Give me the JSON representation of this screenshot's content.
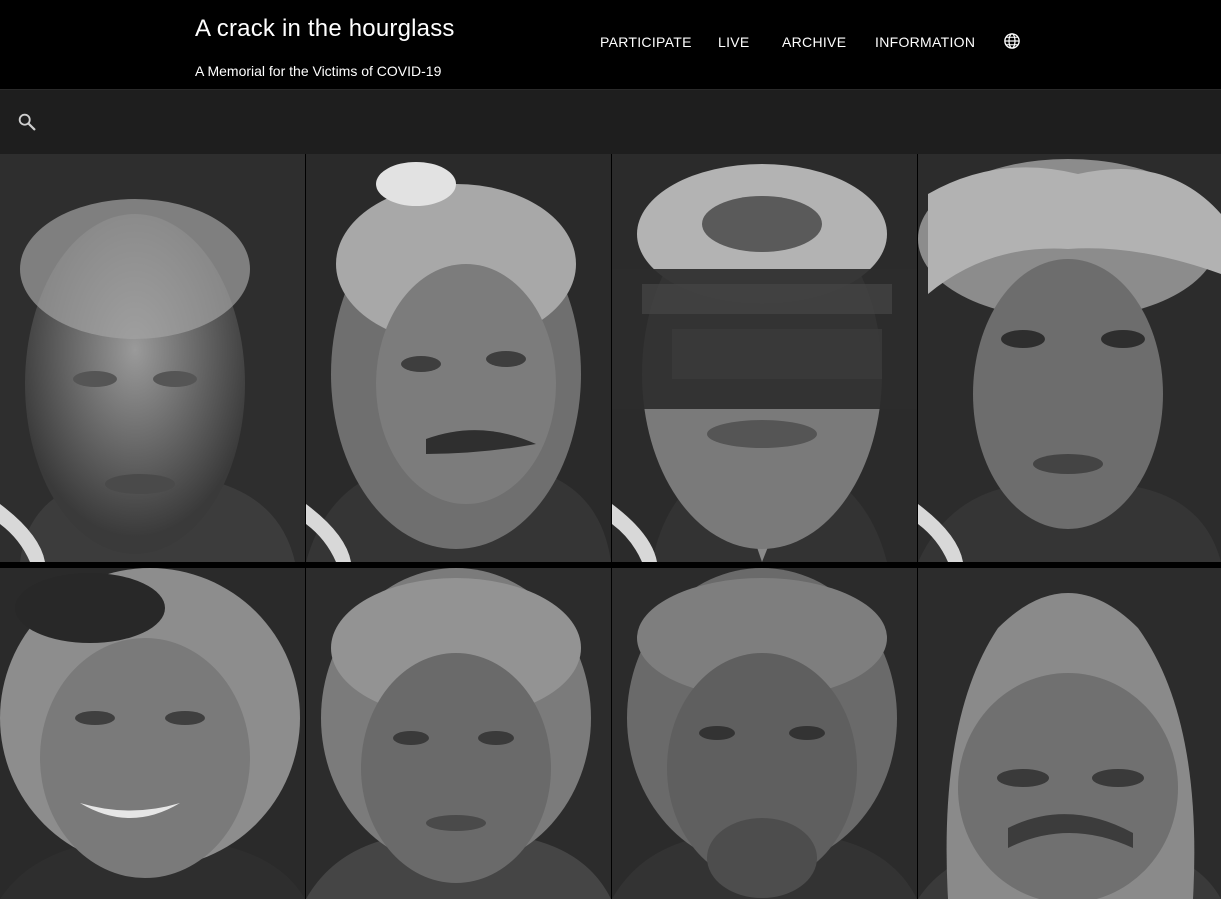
{
  "header": {
    "title": "A crack in the hourglass",
    "subtitle": "A Memorial for the Victims of COVID-19",
    "nav": [
      {
        "label": "PARTICIPATE"
      },
      {
        "label": "LIVE"
      },
      {
        "label": "ARCHIVE"
      },
      {
        "label": "INFORMATION"
      }
    ],
    "language_icon": "globe-icon"
  },
  "search": {
    "icon": "search-icon"
  },
  "gallery": {
    "portraits": [
      {
        "name": "portrait-1",
        "variant": "elderly-man-smiling"
      },
      {
        "name": "portrait-2",
        "variant": "man-mustache"
      },
      {
        "name": "portrait-3",
        "variant": "man-suit-redacted-band"
      },
      {
        "name": "portrait-4",
        "variant": "woman-headscarf"
      },
      {
        "name": "portrait-5",
        "variant": "woman-smiling"
      },
      {
        "name": "portrait-6",
        "variant": "elderly-woman"
      },
      {
        "name": "portrait-7",
        "variant": "woman-hand-to-face"
      },
      {
        "name": "portrait-8",
        "variant": "elderly-woman-wrinkled"
      }
    ]
  },
  "colors": {
    "header_bg": "#000000",
    "searchbar_bg": "#1e1e1e",
    "text": "#ffffff",
    "portrait_tone": "#8a8a8a"
  }
}
